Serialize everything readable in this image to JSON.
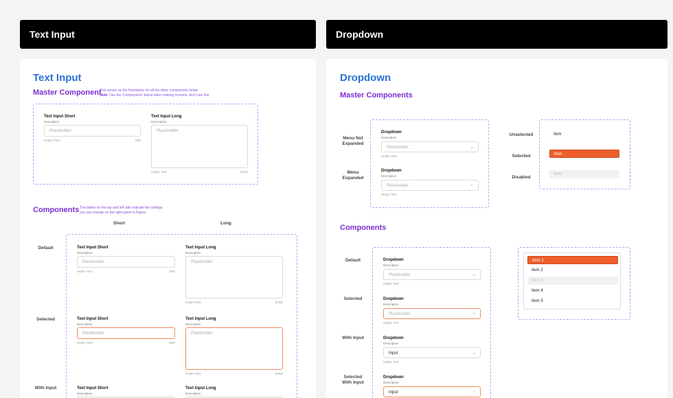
{
  "headers": {
    "left": "Text Input",
    "right": "Dropdown"
  },
  "text_input": {
    "title": "Text Input",
    "master_heading": "Master Component",
    "master_note_line1": "This serves as the foundation for all the other components below",
    "master_note_bold": "Note:",
    "master_note_line2": " Use the 'Components' below when making screens, don't use this",
    "components_heading": "Components",
    "components_note_line1": "The labels on the top and left side indicate the settings",
    "components_note_line2": "you can change on the right panel in Figma",
    "col_short": "Short",
    "col_long": "Long",
    "rows": {
      "default": "Default",
      "selected": "Selected",
      "with_input": "With Input"
    },
    "short_label": "Text Input Short",
    "long_label": "Text Input Long",
    "description": "Description",
    "placeholder": "Placeholder",
    "helper": "Helper Text",
    "count_short": "0/50",
    "count_long": "0/250"
  },
  "dropdown": {
    "title": "Dropdown",
    "master_heading": "Master Components",
    "components_heading": "Components",
    "label": "Dropdown",
    "description": "Description",
    "placeholder": "Placeholder",
    "helper": "Helper Text",
    "input_value": "Input",
    "master_rows": {
      "not_expanded": "Menu Not\nExpanded",
      "expanded": "Menu\nExpanded"
    },
    "item_states": {
      "unselected": "Unselected",
      "selected": "Selected",
      "disabled": "Disabled"
    },
    "item_text": "Item",
    "rows": {
      "default": "Default",
      "selected": "Selected",
      "with_input": "With Input",
      "selected_with_input": "Selected\nWith Input"
    },
    "menu_items": [
      "Item 1",
      "Item 2",
      "Item 3",
      "Item 4",
      "Item 5"
    ],
    "colors": {
      "accent": "#ee5f2a",
      "disabled_bg": "#f1f1f3"
    }
  }
}
